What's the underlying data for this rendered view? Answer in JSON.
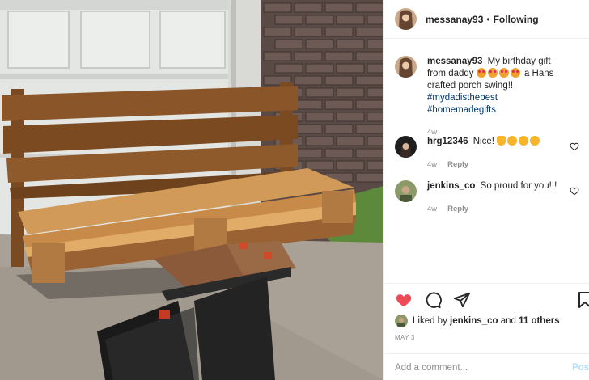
{
  "post": {
    "author": "messanay93",
    "separator": "•",
    "follow_status": "Following"
  },
  "caption": {
    "user": "messanay93",
    "text_before": "My birthday gift from daddy",
    "emoji_count": 4,
    "text_after": "a Hans crafted porch swing!!",
    "hashtag_1": "#mydadisthebest",
    "hashtag_2": "#homemadegifts",
    "time": "4w"
  },
  "comments": [
    {
      "user": "hrg12346",
      "text": "Nice!",
      "time": "4w",
      "reply_label": "Reply"
    },
    {
      "user": "jenkins_co",
      "text": "So proud for you!!!",
      "time": "4w",
      "reply_label": "Reply"
    }
  ],
  "likes": {
    "prefix": "Liked by",
    "user": "jenkins_co",
    "joiner": "and",
    "others": "11 others"
  },
  "date": "MAY 3",
  "add_comment": {
    "placeholder": "Add a comment...",
    "post_label": "Post"
  },
  "icons": {
    "like": "heart-filled-icon",
    "comment": "comment-bubble-icon",
    "share": "paper-plane-icon",
    "save": "bookmark-icon"
  },
  "colors": {
    "like_red": "#ed4956",
    "link_blue": "#00376b",
    "post_disabled": "#b2dffc",
    "muted": "#8e8e8e"
  }
}
